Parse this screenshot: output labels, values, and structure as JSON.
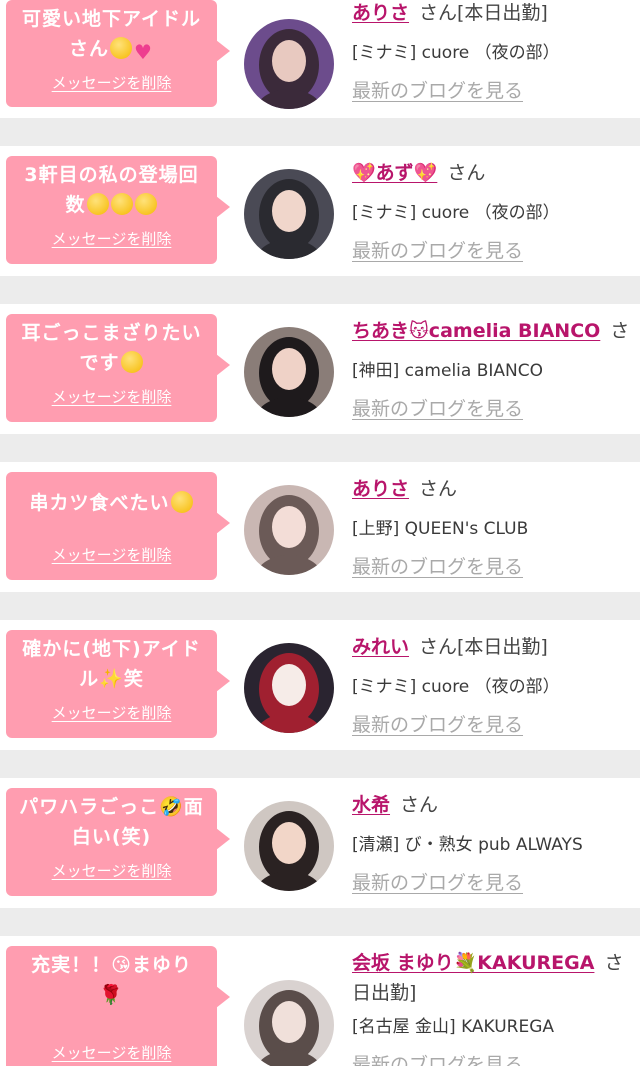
{
  "delete_label": "メッセージを削除",
  "blog_label": "最新のブログを見る",
  "colors": {
    "page_background": "#ececec",
    "card_background": "#ffffff",
    "bubble_pink": "#ff9db0",
    "name_link": "#b8156b",
    "blog_link_gray": "#a9a9a9"
  },
  "messages": [
    {
      "message_lines": [
        "可愛い地下アイドル",
        "さん"
      ],
      "message_emojis": [
        "flushed-face-emoji",
        "sparkling-heart-emoji"
      ],
      "name": "ありさ",
      "suffix": "さん[本日出勤]",
      "shop": "[ミナミ] cuore （夜の部）"
    },
    {
      "message_lines": [
        "3軒目の私の登場回",
        "数"
      ],
      "message_emojis": [
        "rolling-laughing-emoji",
        "rolling-laughing-emoji",
        "rolling-laughing-emoji"
      ],
      "name": "💖あず💖",
      "suffix": "さん",
      "shop": "[ミナミ] cuore （夜の部）"
    },
    {
      "message_lines": [
        "耳ごっこまざりたい",
        "です"
      ],
      "message_emojis": [
        "smiling-hearts-emoji"
      ],
      "name": "ちあき😽camelia BIANCO",
      "suffix": "さ",
      "shop": "[神田] camelia BIANCO"
    },
    {
      "message_lines": [
        "串カツ食べたい"
      ],
      "message_emojis": [
        "heart-eyes-emoji"
      ],
      "name": "ありさ",
      "suffix": "さん",
      "shop": "[上野] QUEEN's CLUB"
    },
    {
      "message_lines": [
        "確かに(地下)アイド",
        "ル✨笑"
      ],
      "message_emojis": [],
      "name": "みれい",
      "suffix": "さん[本日出勤]",
      "shop": "[ミナミ] cuore （夜の部）"
    },
    {
      "message_lines": [
        "パワハラごっこ🤣面",
        "白い(笑)"
      ],
      "message_emojis": [],
      "name": "水希",
      "suffix": "さん",
      "shop": "[清瀬] び・熟女 pub ALWAYS"
    },
    {
      "message_lines": [
        "充実！！😘まゆり",
        "🌹"
      ],
      "message_emojis": [],
      "name": "会坂 まゆり💐KAKUREGA",
      "suffix": "さ",
      "name_continuation": "日出勤]",
      "shop": "[名古屋 金山] KAKUREGA"
    }
  ]
}
